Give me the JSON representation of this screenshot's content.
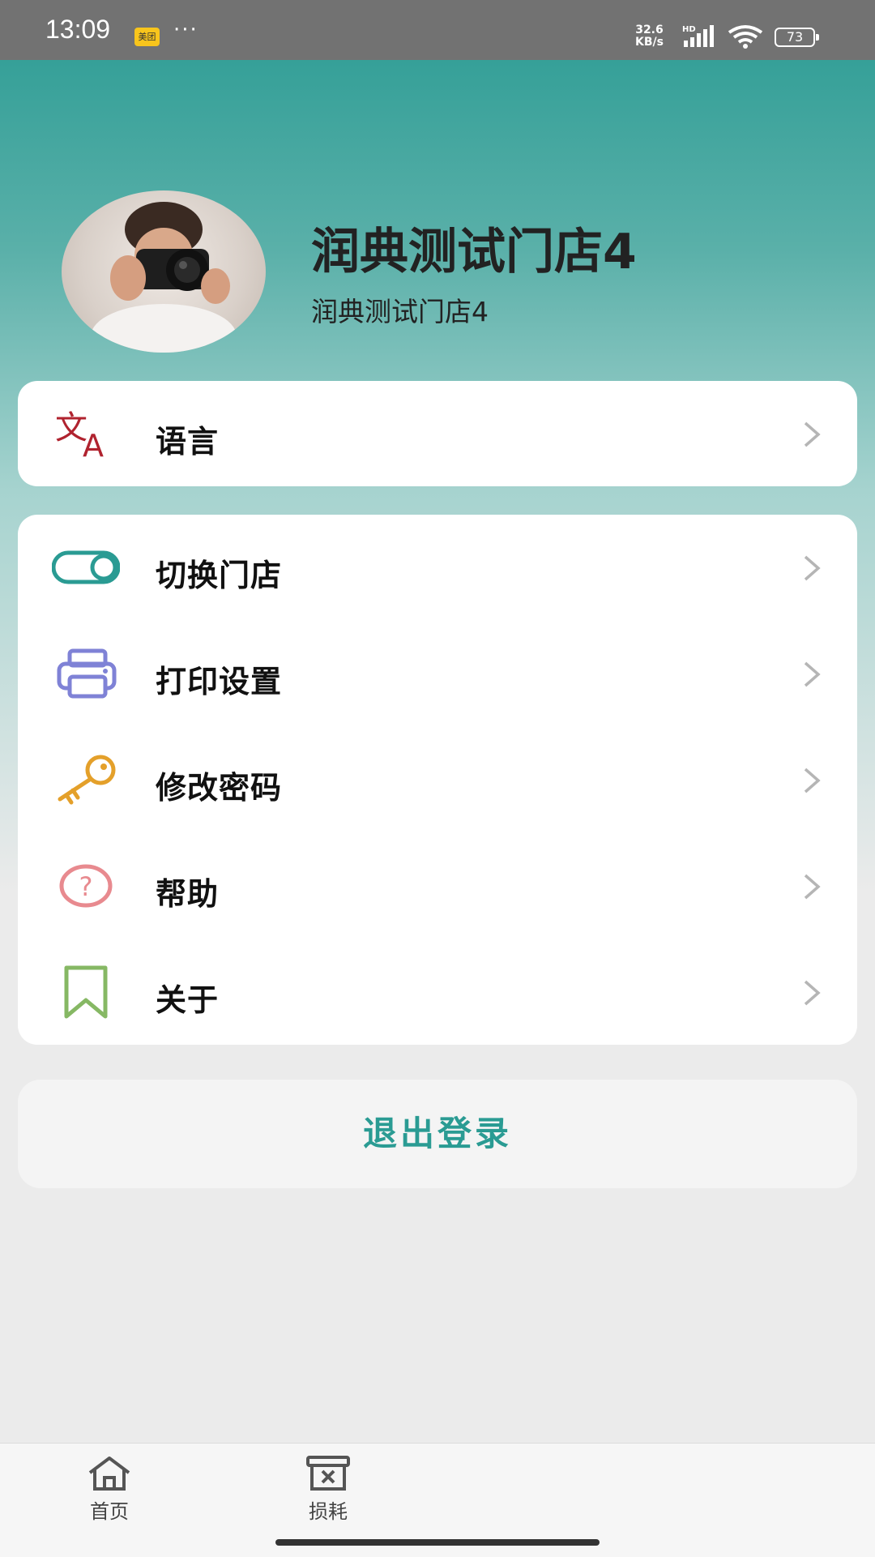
{
  "status_bar": {
    "time": "13:09",
    "app_badge": "美团",
    "more": "···",
    "network_speed_value": "32.6",
    "network_speed_unit": "KB/s",
    "network_type": "HD",
    "battery": "73"
  },
  "profile": {
    "store_name": "润典测试门店4",
    "store_sub": "润典测试门店4"
  },
  "menu_group_1": [
    {
      "label": "语言",
      "icon": "translate-icon",
      "color": "#b0232f"
    }
  ],
  "menu_group_2": [
    {
      "label": "切换门店",
      "icon": "toggle-icon",
      "color": "#2a9b93"
    },
    {
      "label": "打印设置",
      "icon": "printer-icon",
      "color": "#7f82d6"
    },
    {
      "label": "修改密码",
      "icon": "key-icon",
      "color": "#e4a02a"
    },
    {
      "label": "帮助",
      "icon": "help-icon",
      "color": "#e88a8f"
    },
    {
      "label": "关于",
      "icon": "bookmark-icon",
      "color": "#86b864"
    }
  ],
  "logout_label": "退出登录",
  "tabbar": [
    {
      "label": "首页",
      "icon": "home-icon"
    },
    {
      "label": "损耗",
      "icon": "loss-box-icon"
    }
  ],
  "colors": {
    "accent": "#2a9b93"
  }
}
